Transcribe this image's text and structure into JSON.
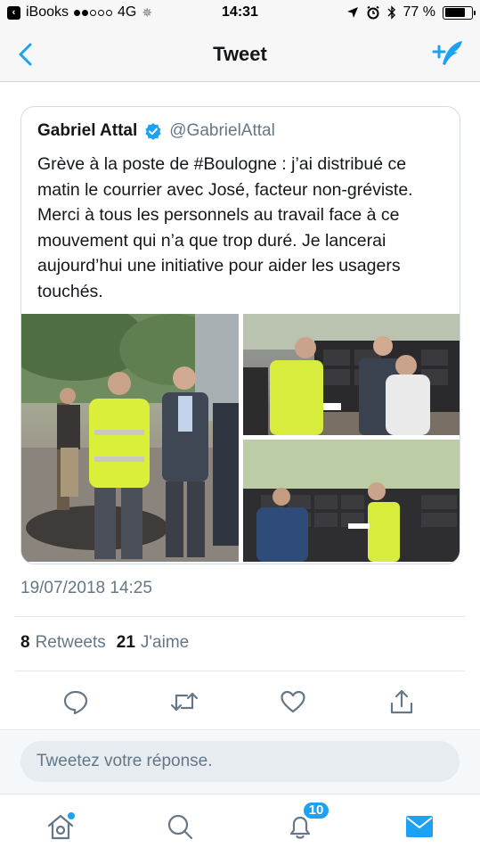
{
  "status_bar": {
    "back_app": "iBooks",
    "network": "4G",
    "time": "14:31",
    "battery_percent": "77 %",
    "battery_level": 0.77
  },
  "nav": {
    "title": "Tweet",
    "back_icon": "chevron-left-icon",
    "compose_icon": "compose-tweet-icon"
  },
  "tweet": {
    "author_name": "Gabriel Attal",
    "author_handle": "@GabrielAttal",
    "text": "Grève à la poste de #Boulogne : j’ai distribué ce matin le courrier avec José, facteur non-gréviste. Merci à tous les personnels au travail face à ce mouvement qui n’a que trop duré. Je lancerai aujourd’hui une initiative pour aider les usagers touchés.",
    "timestamp": "19/07/2018 14:25",
    "retweets_count": "8",
    "retweets_label": "Retweets",
    "likes_count": "21",
    "likes_label": "J'aime"
  },
  "reply": {
    "placeholder": "Tweetez votre réponse."
  },
  "tab_bar": {
    "notifications_badge": "10"
  },
  "colors": {
    "accent": "#1da1f2",
    "text_secondary": "#657786",
    "icon_gray": "#657786"
  }
}
